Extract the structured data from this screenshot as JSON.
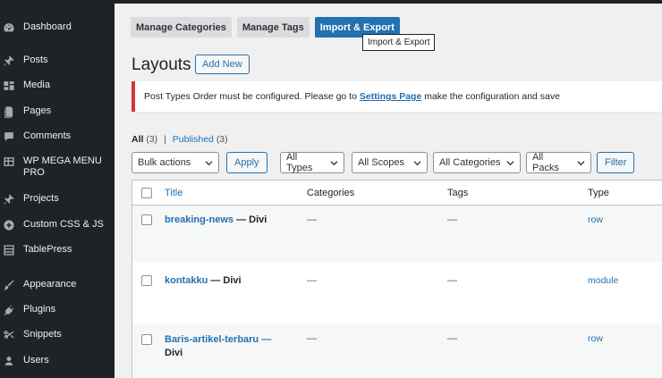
{
  "sidebar": {
    "items": [
      {
        "label": "Dashboard",
        "icon": "dashboard-icon"
      },
      {
        "label": "Posts",
        "icon": "pin-icon"
      },
      {
        "label": "Media",
        "icon": "media-icon"
      },
      {
        "label": "Pages",
        "icon": "pages-icon"
      },
      {
        "label": "Comments",
        "icon": "comment-icon"
      },
      {
        "label": "WP MEGA MENU PRO",
        "icon": "menu-grid-icon"
      },
      {
        "label": "Projects",
        "icon": "pin-icon"
      },
      {
        "label": "Custom CSS & JS",
        "icon": "plus-circle-icon"
      },
      {
        "label": "TablePress",
        "icon": "table-icon"
      },
      {
        "label": "Appearance",
        "icon": "brush-icon"
      },
      {
        "label": "Plugins",
        "icon": "plug-icon"
      },
      {
        "label": "Snippets",
        "icon": "scissors-icon"
      },
      {
        "label": "Users",
        "icon": "user-icon"
      }
    ]
  },
  "tabs": [
    {
      "label": "Manage Categories",
      "active": false
    },
    {
      "label": "Manage Tags",
      "active": false
    },
    {
      "label": "Import & Export",
      "active": true
    }
  ],
  "tooltip": "Import & Export",
  "page_title": "Layouts",
  "add_new_label": "Add New",
  "notice": {
    "before": "Post Types Order must be configured. Please go to ",
    "link": "Settings Page",
    "after": " make the configuration and save"
  },
  "filters": {
    "all_label": "All",
    "all_count": "(3)",
    "sep": "|",
    "published_label": "Published",
    "published_count": "(3)"
  },
  "controls": {
    "bulk_actions": "Bulk actions",
    "apply": "Apply",
    "all_types": "All Types",
    "all_scopes": "All Scopes",
    "all_categories": "All Categories",
    "all_packs": "All Packs",
    "filter": "Filter"
  },
  "table": {
    "headers": {
      "title": "Title",
      "categories": "Categories",
      "tags": "Tags",
      "type": "Type"
    },
    "rows": [
      {
        "title": "breaking-news",
        "suffix": "— Divi",
        "categories": "—",
        "tags": "—",
        "type": "row"
      },
      {
        "title": "kontakku",
        "suffix": "— Divi",
        "categories": "—",
        "tags": "—",
        "type": "module"
      },
      {
        "title": "Baris-artikel-terbaru —",
        "suffix": "Divi",
        "categories": "—",
        "tags": "—",
        "type": "row"
      }
    ]
  },
  "colors": {
    "sidebar_bg": "#1d2327",
    "accent": "#2271b1",
    "notice_border": "#d63638"
  }
}
